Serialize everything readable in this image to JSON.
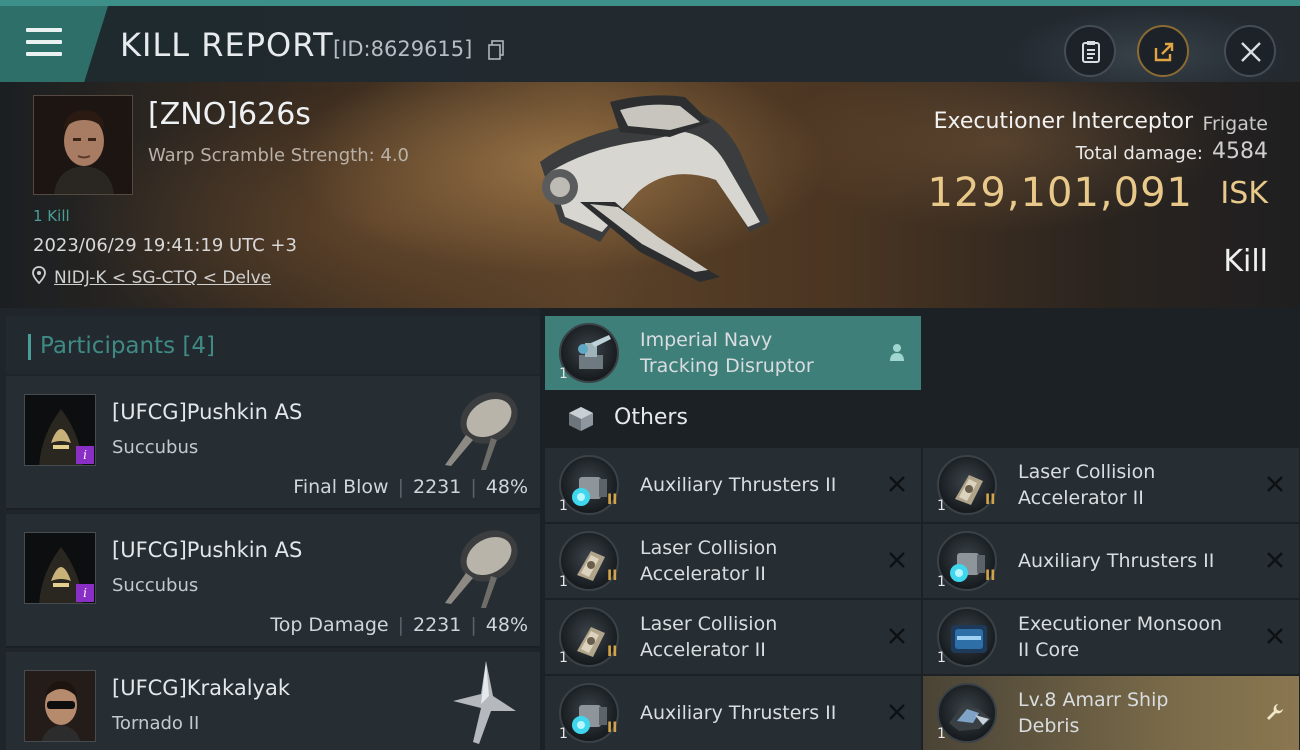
{
  "header": {
    "title": "KILL REPORT",
    "report_id": "[ID:8629615]"
  },
  "victim": {
    "name": "[ZNO]626s",
    "warp_scramble": "Warp Scramble Strength: 4.0",
    "kills": "1 Kill",
    "datetime": "2023/06/29 19:41:19 UTC +3",
    "location": "NIDJ-K < SG-CTQ < Delve",
    "ship_type": "Executioner Interceptor",
    "ship_class": "Frigate",
    "total_damage_label": "Total damage:",
    "total_damage": "4584",
    "isk_value": "129,101,091",
    "isk_unit": "ISK",
    "result": "Kill"
  },
  "participants": {
    "title": "Participants [4]",
    "items": [
      {
        "name": "[UFCG]Pushkin AS",
        "ship": "Succubus",
        "role": "Final Blow",
        "damage": "2231",
        "percent": "48%",
        "has_badge": true,
        "badge": "i"
      },
      {
        "name": "[UFCG]Pushkin AS",
        "ship": "Succubus",
        "role": "Top Damage",
        "damage": "2231",
        "percent": "48%",
        "has_badge": true,
        "badge": "i"
      },
      {
        "name": "[UFCG]Krakalyak",
        "ship": "Tornado II",
        "role": "",
        "damage": "",
        "percent": "",
        "has_badge": false
      }
    ]
  },
  "fitting": {
    "top_slot": {
      "name": "Imperial Navy Tracking Disruptor",
      "line1": "Imperial Navy",
      "line2": "Tracking Disruptor",
      "qty": "1"
    },
    "others_title": "Others",
    "others": [
      {
        "line1": "Auxiliary Thrusters II",
        "line2": "",
        "qty": "1",
        "tier": "II",
        "kind": "thruster"
      },
      {
        "line1": "Laser Collision",
        "line2": "Accelerator II",
        "qty": "1",
        "tier": "II",
        "kind": "laser"
      },
      {
        "line1": "Laser Collision",
        "line2": "Accelerator II",
        "qty": "1",
        "tier": "II",
        "kind": "laser"
      },
      {
        "line1": "Auxiliary Thrusters II",
        "line2": "",
        "qty": "1",
        "tier": "II",
        "kind": "thruster"
      },
      {
        "line1": "Laser Collision",
        "line2": "Accelerator II",
        "qty": "1",
        "tier": "II",
        "kind": "laser"
      },
      {
        "line1": "Executioner Monsoon",
        "line2": "II Core",
        "qty": "1",
        "tier": "",
        "kind": "core"
      },
      {
        "line1": "Auxiliary Thrusters II",
        "line2": "",
        "qty": "1",
        "tier": "II",
        "kind": "thruster"
      },
      {
        "line1": "Lv.8 Amarr Ship",
        "line2": "Debris",
        "qty": "1",
        "tier": "",
        "kind": "debris"
      }
    ]
  },
  "colors": {
    "accent": "#3e7f79",
    "isk": "#e8c98a",
    "badge": "#8a2fc5"
  }
}
